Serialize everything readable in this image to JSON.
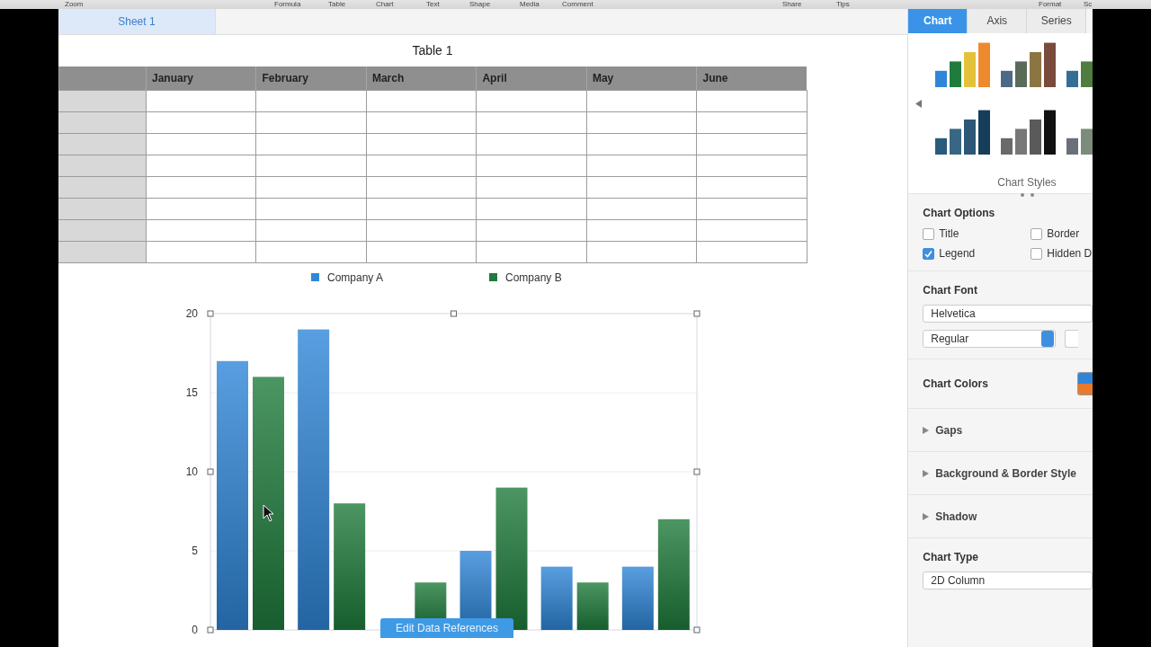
{
  "toolbar": {
    "items": [
      "Zoom",
      "Formula",
      "Table",
      "Chart",
      "Text",
      "Shape",
      "Media",
      "Comment",
      "Share",
      "Tips",
      "Format",
      "Sc"
    ]
  },
  "sheet_tabs": [
    {
      "label": "Sheet 1",
      "selected": true
    }
  ],
  "table": {
    "title": "Table 1",
    "columns": [
      "January",
      "February",
      "March",
      "April",
      "May",
      "June"
    ]
  },
  "chart": {
    "edit_button": "Edit Data References",
    "chart_data": {
      "type": "bar",
      "series": [
        {
          "name": "Company A",
          "color": "#2f86d8",
          "values": [
            17,
            19,
            null,
            5,
            4,
            4
          ]
        },
        {
          "name": "Company B",
          "color": "#1f7c3c",
          "values": [
            16,
            8,
            3,
            9,
            3,
            7
          ]
        }
      ],
      "ylim": [
        0,
        20
      ],
      "yticks": [
        0,
        5,
        10,
        15,
        20
      ],
      "grid": true,
      "legend": true
    }
  },
  "inspector": {
    "tabs": [
      {
        "label": "Chart",
        "selected": true
      },
      {
        "label": "Axis",
        "selected": false
      },
      {
        "label": "Series",
        "selected": false
      }
    ],
    "styles_label": "Chart Styles",
    "chart_options": {
      "title": "Chart Options",
      "items": [
        {
          "label": "Title",
          "checked": false
        },
        {
          "label": "Border",
          "checked": false
        },
        {
          "label": "Legend",
          "checked": true
        },
        {
          "label": "Hidden D",
          "checked": false
        }
      ]
    },
    "chart_font": {
      "title": "Chart Font",
      "font": "Helvetica",
      "style": "Regular"
    },
    "chart_colors": {
      "title": "Chart Colors"
    },
    "sections": [
      {
        "label": "Gaps",
        "expanded": false
      },
      {
        "label": "Background & Border Style",
        "expanded": false
      },
      {
        "label": "Shadow",
        "expanded": false
      }
    ],
    "chart_type": {
      "title": "Chart Type",
      "value": "2D Column"
    }
  }
}
